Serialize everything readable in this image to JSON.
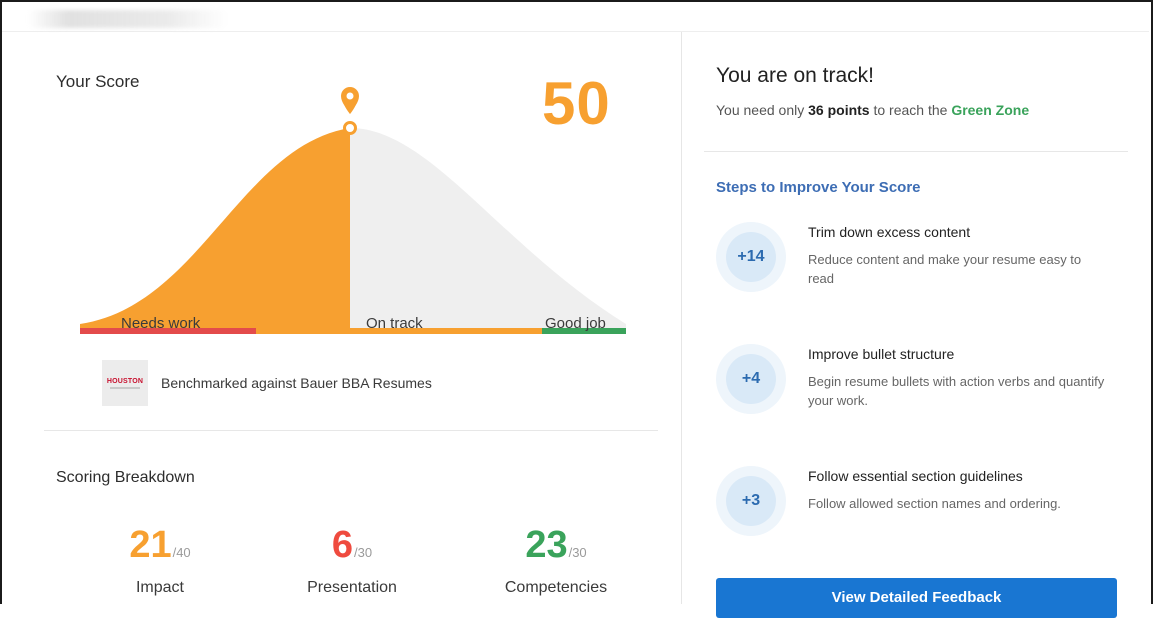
{
  "score": {
    "title": "Your Score",
    "value": "50",
    "zones": [
      "Needs work",
      "On track",
      "Good job"
    ],
    "benchmark": {
      "logo_text": "HOUSTON",
      "text": "Benchmarked against Bauer BBA Resumes"
    },
    "colors": {
      "orange": "#f7a030",
      "red": "#e34b4b",
      "green": "#3aa35b",
      "gray": "#efefef"
    }
  },
  "breakdown": {
    "title": "Scoring Breakdown",
    "metrics": [
      {
        "value": "21",
        "max": "/40",
        "name": "Impact",
        "color": "#f7a030"
      },
      {
        "value": "6",
        "max": "/30",
        "name": "Presentation",
        "color": "#ef4b3f"
      },
      {
        "value": "23",
        "max": "/30",
        "name": "Competencies",
        "color": "#3aa35b"
      }
    ]
  },
  "status": {
    "title": "You are on track!",
    "sub_prefix": "You need only ",
    "sub_points": "36 points",
    "sub_mid": " to reach the ",
    "sub_zone": "Green Zone"
  },
  "steps": {
    "title": "Steps to Improve Your Score",
    "items": [
      {
        "badge": "+14",
        "title": "Trim down excess content",
        "desc": "Reduce content and make your resume easy to read"
      },
      {
        "badge": "+4",
        "title": "Improve bullet structure",
        "desc": "Begin resume bullets with action verbs and quantify your work."
      },
      {
        "badge": "+3",
        "title": "Follow essential section guidelines",
        "desc": "Follow allowed section names and ordering."
      }
    ]
  },
  "cta": {
    "label": "View Detailed Feedback"
  }
}
